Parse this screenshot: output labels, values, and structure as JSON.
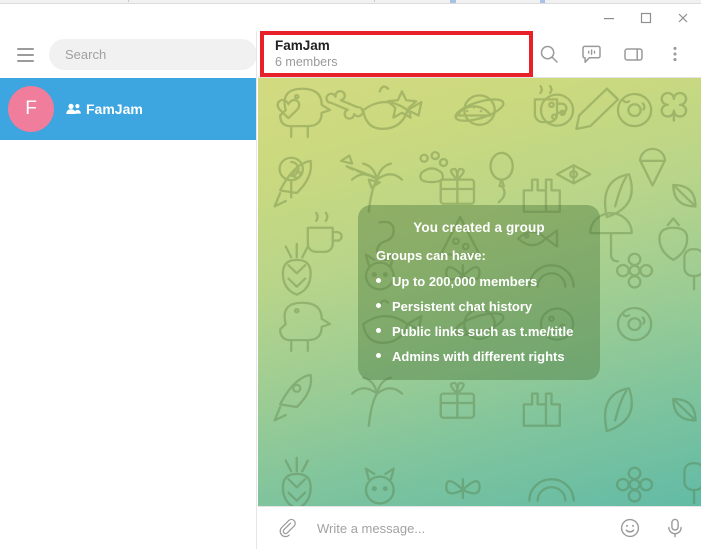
{
  "window": {
    "controls": [
      {
        "name": "minimize",
        "glyph": "minimize-icon"
      },
      {
        "name": "maximize",
        "glyph": "maximize-icon"
      },
      {
        "name": "close",
        "glyph": "close-icon"
      }
    ]
  },
  "sidebar": {
    "menu_icon": "hamburger-menu-icon",
    "search": {
      "placeholder": "Search",
      "value": ""
    },
    "chats": [
      {
        "avatar_letter": "F",
        "avatar_color": "#ef7d9b",
        "title": "FamJam",
        "is_group": true,
        "selected": true,
        "selected_color": "#3da5e0"
      }
    ]
  },
  "chat_header": {
    "title": "FamJam",
    "subtitle": "6 members",
    "actions": [
      {
        "name": "search-icon",
        "label": "Search"
      },
      {
        "name": "voice-chat-icon",
        "label": "Voice chat"
      },
      {
        "name": "sidebar-panel-icon",
        "label": "Info"
      },
      {
        "name": "more-options-icon",
        "label": "More"
      }
    ],
    "highlight_color": "#e8202a"
  },
  "chat": {
    "background_name": "telegram-doodle-pattern",
    "service_message": {
      "heading": "You created a group",
      "subheading": "Groups can have:",
      "bullets": [
        "Up to 200,000 members",
        "Persistent chat history",
        "Public links such as t.me/title",
        "Admins with different rights"
      ]
    }
  },
  "composer": {
    "attach_icon": "paperclip-icon",
    "placeholder": "Write a message...",
    "value": "",
    "emoji_icon": "smiley-icon",
    "voice_icon": "microphone-icon"
  }
}
